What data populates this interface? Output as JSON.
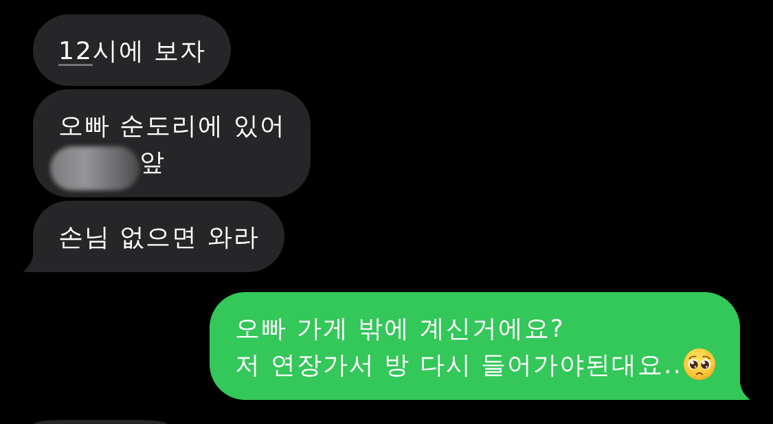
{
  "messages": [
    {
      "kind": "incoming",
      "tail": false,
      "lines": [
        [
          {
            "kind": "link",
            "text": "12"
          },
          {
            "kind": "plain",
            "text": "시에 보자"
          }
        ]
      ]
    },
    {
      "kind": "incoming",
      "tail": false,
      "lines": [
        [
          {
            "kind": "plain",
            "text": "오빠 순도리에 있어"
          }
        ],
        [
          {
            "kind": "blurred"
          },
          {
            "kind": "plain",
            "text": "앞"
          }
        ]
      ]
    },
    {
      "kind": "incoming",
      "tail": true,
      "lines": [
        [
          {
            "kind": "plain",
            "text": "손님 없으면 와라"
          }
        ]
      ]
    },
    {
      "kind": "outgoing",
      "tail": true,
      "lines": [
        [
          {
            "kind": "plain",
            "text": "오빠 가게 밖에 계신거에요?"
          }
        ],
        [
          {
            "kind": "plain",
            "text": "저 연장가서 방 다시 들어가야된대요.."
          },
          {
            "kind": "emoji"
          }
        ]
      ]
    },
    {
      "kind": "incoming",
      "tail": false,
      "cut_off": true
    }
  ]
}
